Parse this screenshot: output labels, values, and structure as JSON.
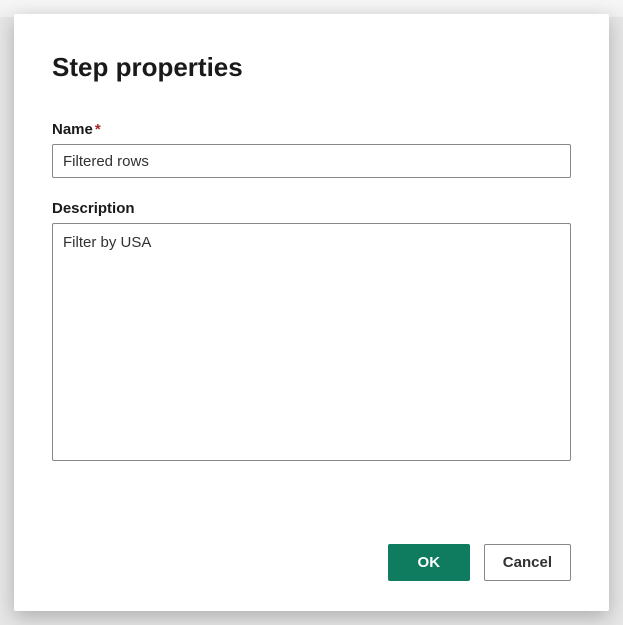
{
  "dialog": {
    "title": "Step properties",
    "name_field": {
      "label": "Name",
      "required_marker": "*",
      "value": "Filtered rows"
    },
    "description_field": {
      "label": "Description",
      "value": "Filter by USA"
    },
    "buttons": {
      "ok_label": "OK",
      "cancel_label": "Cancel"
    }
  },
  "colors": {
    "primary_button": "#0f7b5f",
    "required_indicator": "#a4262c"
  }
}
